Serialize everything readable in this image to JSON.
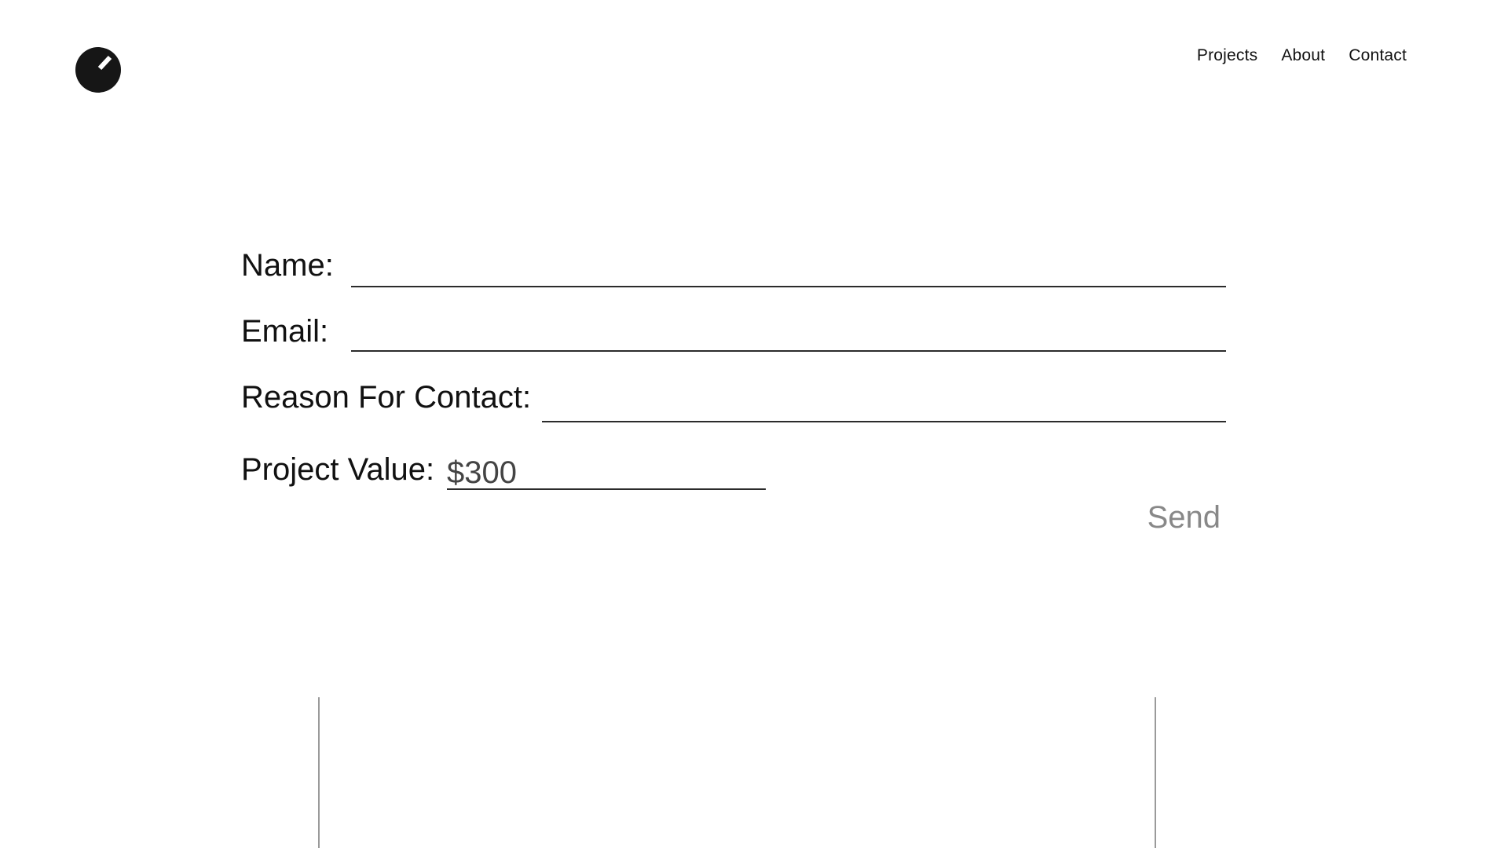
{
  "header": {
    "logo_icon": "gauge-dial-icon",
    "nav": [
      {
        "label": "Projects"
      },
      {
        "label": "About"
      },
      {
        "label": "Contact"
      }
    ]
  },
  "form": {
    "name_label": "Name:",
    "name_value": "",
    "email_label": "Email:",
    "email_value": "",
    "reason_label": "Reason For Contact:",
    "reason_value": "",
    "value_label": "Project Value:",
    "value_placeholder": "$300",
    "send_label": "Send"
  },
  "colors": {
    "text": "#111111",
    "send": "#888888",
    "divider": "#9a9a9a"
  }
}
